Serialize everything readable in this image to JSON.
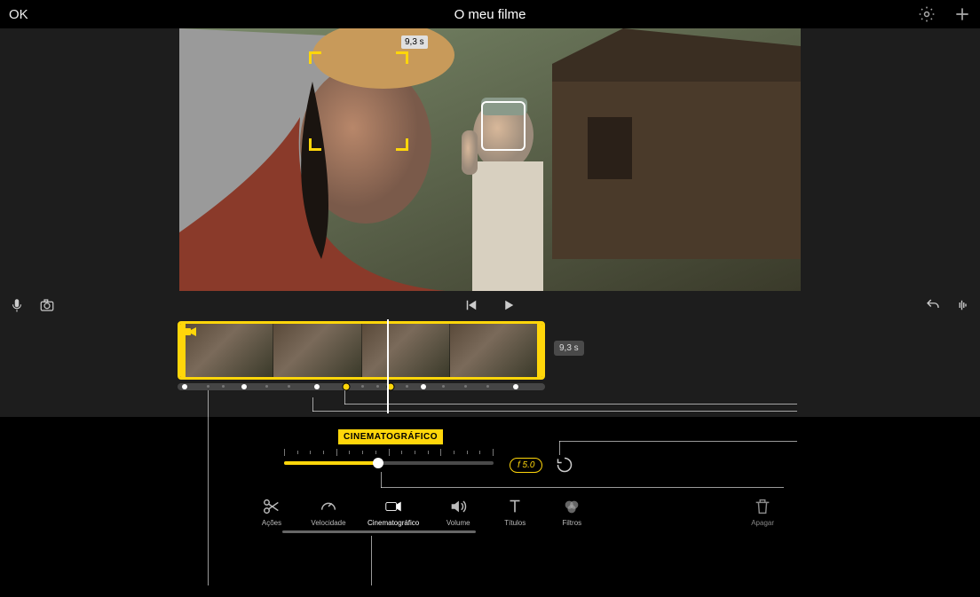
{
  "header": {
    "ok": "OK",
    "title": "O meu filme"
  },
  "preview": {
    "duration_tag": "9,3 s"
  },
  "timeline": {
    "clip_duration": "9,3 s"
  },
  "cine": {
    "label": "CINEMATOGRÁFICO",
    "aperture": "f 5.0",
    "slider_percent": 45
  },
  "tools": {
    "actions": "Ações",
    "speed": "Velocidade",
    "cinemato": "Cinematográfico",
    "volume": "Volume",
    "titles": "Títulos",
    "filters": "Filtros"
  },
  "delete_label": "Apagar"
}
